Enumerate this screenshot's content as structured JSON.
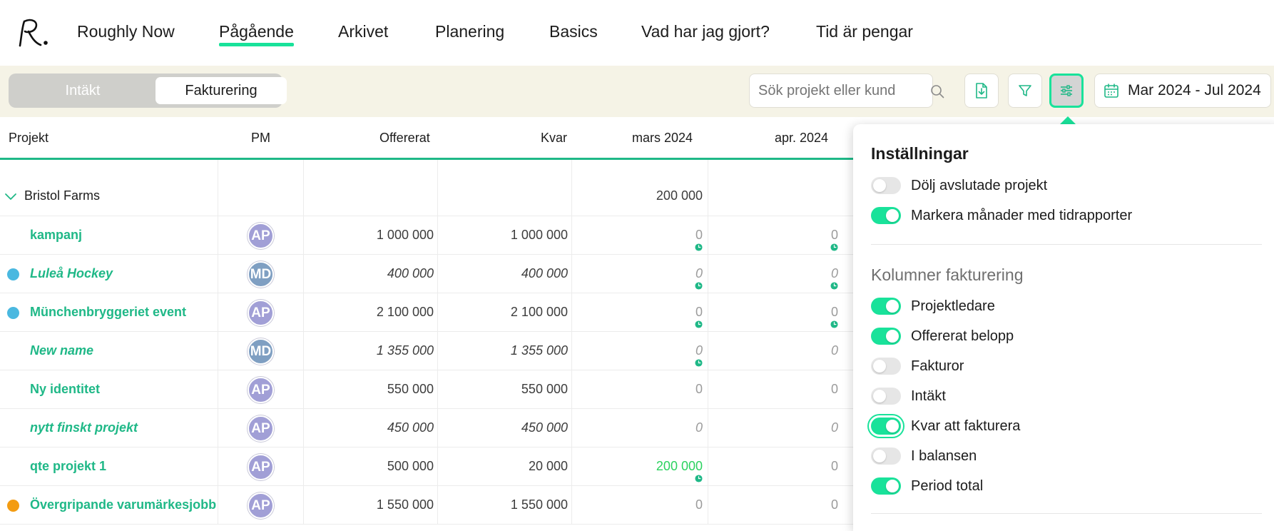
{
  "nav": {
    "items": [
      {
        "label": "Roughly Now"
      },
      {
        "label": "Pågående"
      },
      {
        "label": "Arkivet"
      },
      {
        "label": "Planering"
      },
      {
        "label": "Basics"
      },
      {
        "label": "Vad har jag gjort?"
      },
      {
        "label": "Tid är pengar"
      }
    ],
    "active": "Pågående"
  },
  "toolbar": {
    "tabs": [
      {
        "label": "Intäkt"
      },
      {
        "label": "Fakturering"
      }
    ],
    "selected_tab": "Fakturering",
    "search_placeholder": "Sök projekt eller kund",
    "date_range": "Mar 2024 - Jul 2024",
    "settings_active": true
  },
  "table": {
    "headers": {
      "project": "Projekt",
      "pm": "PM",
      "offered": "Offererat",
      "remaining": "Kvar",
      "month1": "mars 2024",
      "month2": "apr. 2024"
    },
    "group": {
      "name": "Bristol Farms",
      "month1": "200 000"
    },
    "rows": [
      {
        "name": "kampanj",
        "pm": "AP",
        "offered": "1 000 000",
        "remaining": "1 000 000",
        "m1": "0",
        "m2": "0",
        "italic": false
      },
      {
        "name": "Luleå Hockey",
        "pm": "MD",
        "offered": "400 000",
        "remaining": "400 000",
        "m1": "0",
        "m2": "0",
        "italic": true
      },
      {
        "name": "Münchenbryggeriet event",
        "pm": "AP",
        "offered": "2 100 000",
        "remaining": "2 100 000",
        "m1": "0",
        "m2": "0",
        "italic": false
      },
      {
        "name": "New name",
        "pm": "MD",
        "offered": "1 355 000",
        "remaining": "1 355 000",
        "m1": "0",
        "m2": "0",
        "italic": true
      },
      {
        "name": "Ny identitet",
        "pm": "AP",
        "offered": "550 000",
        "remaining": "550 000",
        "m1": "0",
        "m2": "0",
        "italic": false
      },
      {
        "name": "nytt finskt projekt",
        "pm": "AP",
        "offered": "450 000",
        "remaining": "450 000",
        "m1": "0",
        "m2": "0",
        "italic": true
      },
      {
        "name": "qte projekt 1",
        "pm": "AP",
        "offered": "500 000",
        "remaining": "20 000",
        "m1": "200 000",
        "m2": "0",
        "italic": false
      },
      {
        "name": "Övergripande varumärkesjobb",
        "pm": "AP",
        "offered": "1 550 000",
        "remaining": "1 550 000",
        "m1": "0",
        "m2": "0",
        "italic": false
      }
    ]
  },
  "settings": {
    "title": "Inställningar",
    "general": [
      {
        "label": "Dölj avslutade projekt",
        "on": false
      },
      {
        "label": "Markera månader med tidrapporter",
        "on": true
      }
    ],
    "columns_title": "Kolumner fakturering",
    "columns": [
      {
        "label": "Projektledare",
        "on": true
      },
      {
        "label": "Offererat belopp",
        "on": true
      },
      {
        "label": "Fakturor",
        "on": false
      },
      {
        "label": "Intäkt",
        "on": false
      },
      {
        "label": "Kvar att fakturera",
        "on": true
      },
      {
        "label": "I balansen",
        "on": false
      },
      {
        "label": "Period total",
        "on": true
      }
    ]
  },
  "colors": {
    "accent": "#19e29a",
    "project_text": "#1fb887",
    "avatar_ap": "#a19fd6",
    "avatar_md": "#7f9fc2",
    "dot_blue": "#4ab8e0",
    "dot_orange": "#f39c12",
    "highlight_value": "#2bd25f"
  }
}
